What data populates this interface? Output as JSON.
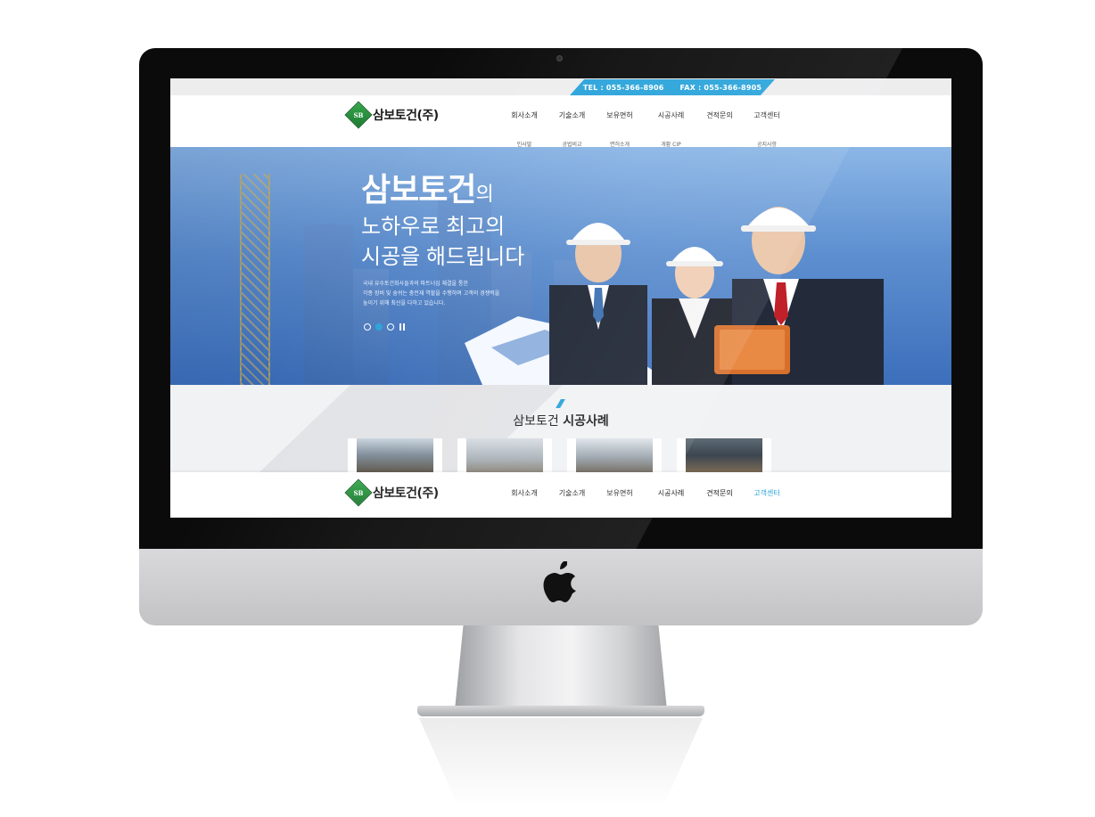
{
  "site": {
    "brand": {
      "mark": "SB",
      "name": "삼보토건(주)"
    },
    "contact": {
      "tel": "TEL : 055-366-8906",
      "fax": "FAX : 055-366-8905"
    },
    "nav": [
      {
        "label": "회사소개",
        "sub": "인사말"
      },
      {
        "label": "기술소개",
        "sub": "공법비교"
      },
      {
        "label": "보유면허",
        "sub": "면허소개"
      },
      {
        "label": "시공사례",
        "sub": "개황 CIP"
      },
      {
        "label": "견적문의",
        "sub": ""
      },
      {
        "label": "고객센터",
        "sub": "공지사항"
      }
    ],
    "hero": {
      "title_strong": "삼보토건",
      "title_suffix": "의",
      "line2": "노하우로 최고의",
      "line3": "시공을 해드립니다",
      "desc1": "국내 유수토건회사들과의 파트너십 체결을 통한",
      "desc2": "각종 장비 및 숨쉬는 충전재 역할을 수행하며 고객의 경쟁력을",
      "desc3": "높이기 위해 최선을 다하고 있습니다."
    },
    "cases": {
      "title_light": "삼보토건",
      "title_bold": "시공사례"
    },
    "sticky_nav": [
      {
        "label": "회사소개"
      },
      {
        "label": "기술소개"
      },
      {
        "label": "보유면허"
      },
      {
        "label": "시공사례"
      },
      {
        "label": "견적문의"
      },
      {
        "label": "고객센터"
      }
    ]
  },
  "colors": {
    "accent": "#29a3da",
    "brand_green": "#36a84a",
    "bezel": "#0b0b0b"
  }
}
